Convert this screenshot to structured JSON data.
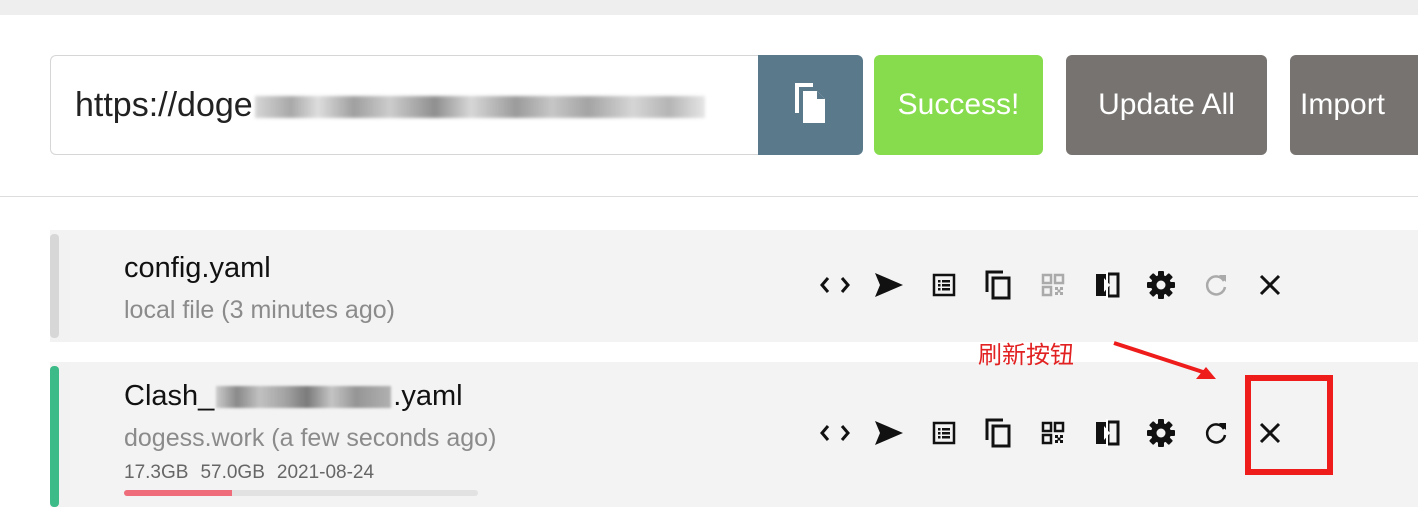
{
  "subscription": {
    "url_value": "https://doge",
    "copy_icon": "copy-icon",
    "success_label": "Success!",
    "update_all_label": "Update All",
    "import_label": "Import"
  },
  "profiles": [
    {
      "name": "config.yaml",
      "source": "local file (3 minutes ago)",
      "selected": false
    },
    {
      "name_prefix": "Clash_",
      "name_suffix": ".yaml",
      "source": "dogess.work (a few seconds ago)",
      "selected": true,
      "used": "17.3GB",
      "total": "57.0GB",
      "expire": "2021-08-24",
      "usage_fraction": 0.304
    }
  ],
  "actions": [
    "code-icon",
    "send-icon",
    "list-icon",
    "copy-icon",
    "qrcode-icon",
    "compare-icon",
    "settings-icon",
    "refresh-icon",
    "close-icon"
  ],
  "annotation": {
    "label": "刷新按钮"
  },
  "colors": {
    "success": "#86dc4c",
    "secondary": "#777370",
    "copy_button": "#5a7a8c",
    "active_stripe": "#3cba87",
    "usage_bar": "#ef6c7a",
    "annotation": "#ef1c1c"
  }
}
